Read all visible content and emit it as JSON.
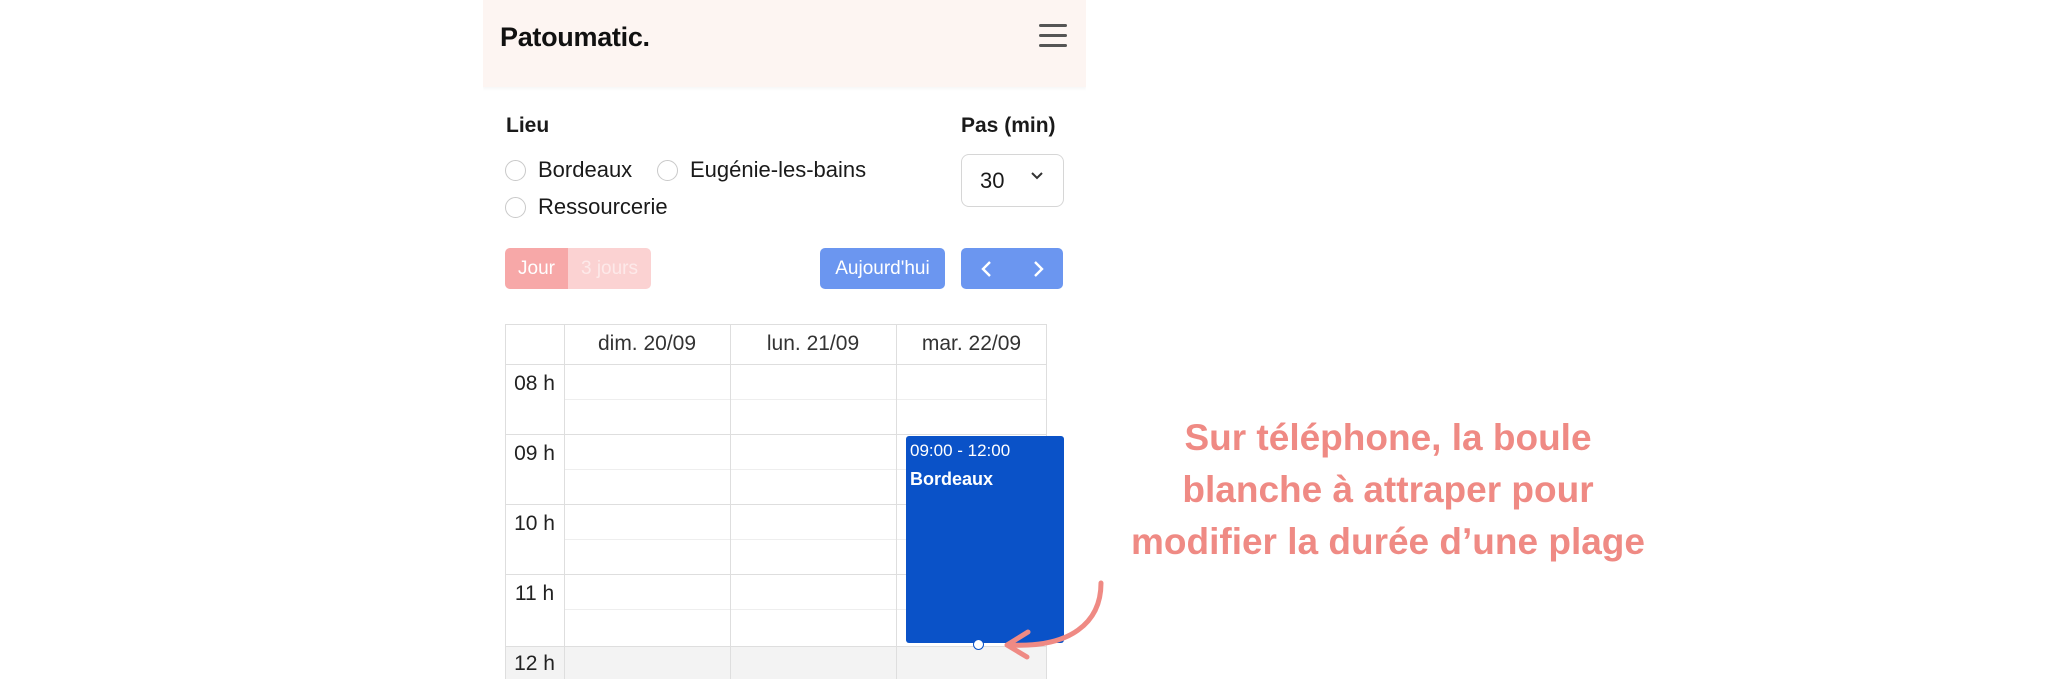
{
  "app": {
    "brand": "Patoumatic.",
    "menu_icon": "hamburger-icon"
  },
  "filters": {
    "lieu_label": "Lieu",
    "lieu_options": [
      "Bordeaux",
      "Eugénie-les-bains",
      "Ressourcerie"
    ],
    "pas_label": "Pas (min)",
    "pas_value": "30"
  },
  "toolbar": {
    "view_day": "Jour",
    "view_3days": "3 jours",
    "today": "Aujourd'hui",
    "prev_icon": "chevron-left-icon",
    "next_icon": "chevron-right-icon"
  },
  "calendar": {
    "days": [
      "dim. 20/09",
      "lun. 21/09",
      "mar. 22/09"
    ],
    "hours": [
      "08 h",
      "09 h",
      "10 h",
      "11 h",
      "12 h"
    ],
    "event": {
      "time": "09:00 - 12:00",
      "place": "Bordeaux",
      "color": "#0a52c8"
    }
  },
  "annotation": {
    "lines": [
      "Sur téléphone, la boule",
      "blanche à attraper pour",
      "modifier la durée d’une plage"
    ],
    "color": "#ef8a84"
  },
  "colors": {
    "topbar": "#fdf5f2",
    "primary_button": "#6b96f0",
    "active_toggle": "#f7a8a8"
  }
}
